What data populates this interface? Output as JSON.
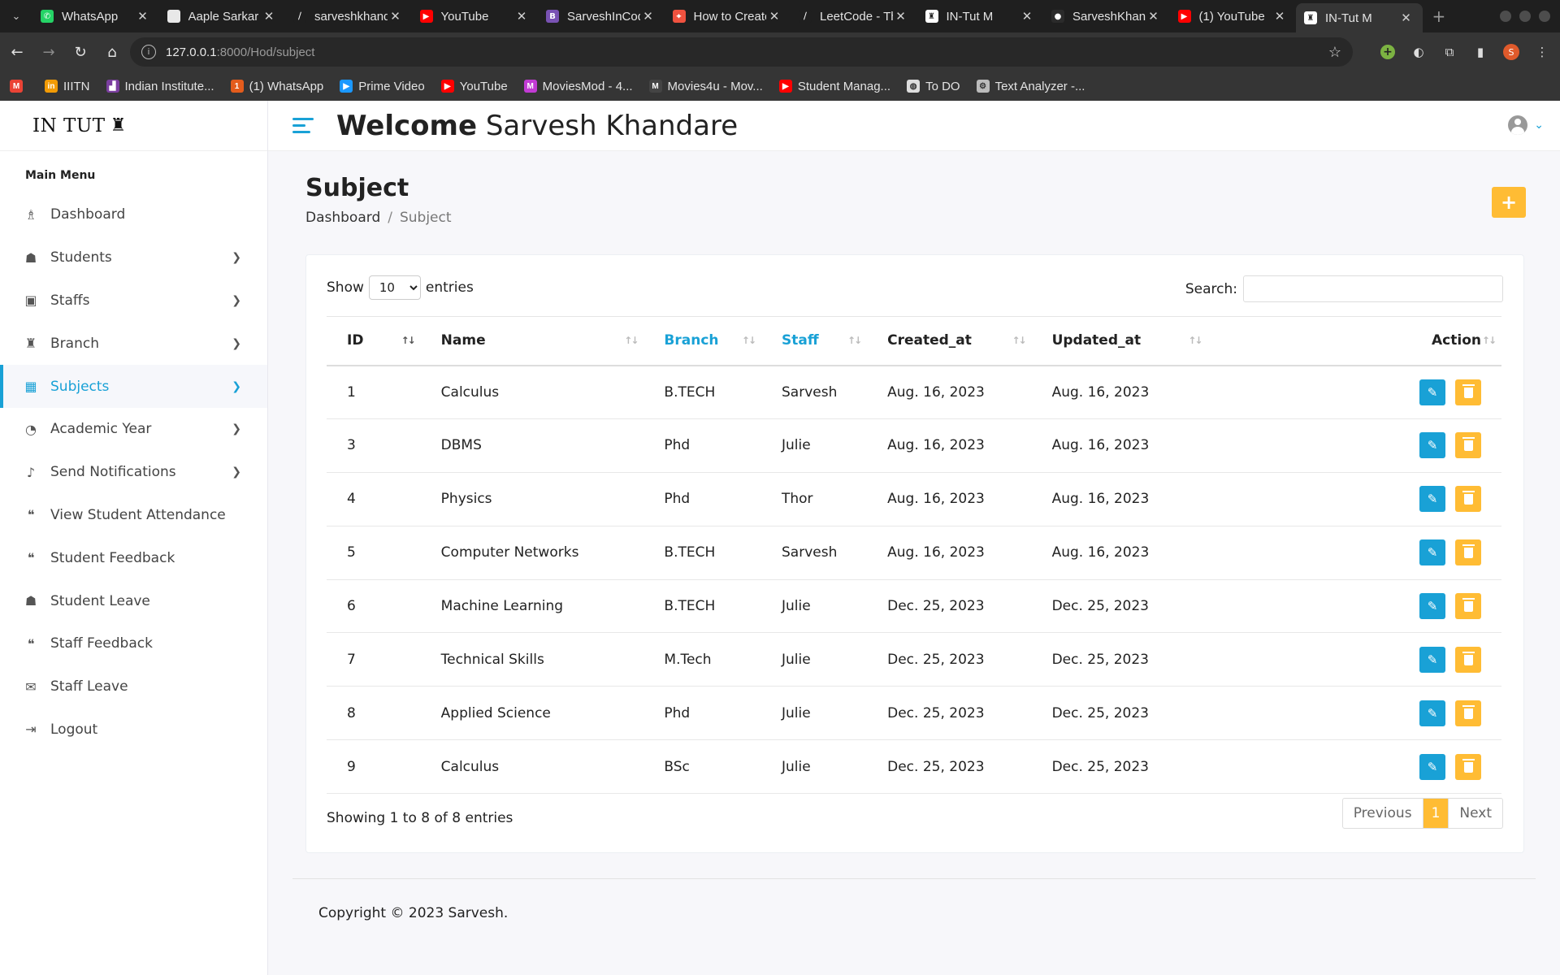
{
  "browser": {
    "tabs": [
      {
        "title": "WhatsApp",
        "icon": "whatsapp-icon",
        "color": "#25d366",
        "glyph": "✆"
      },
      {
        "title": "Aaple Sarkar",
        "icon": "document-icon",
        "color": "#e8e8e8",
        "glyph": ""
      },
      {
        "title": "sarveshkhandare",
        "icon": "hackerrank-icon",
        "color": "#1f1f1f",
        "glyph": "⧸"
      },
      {
        "title": "YouTube",
        "icon": "youtube-icon",
        "color": "#ff0000",
        "glyph": "▶"
      },
      {
        "title": "SarveshInCode",
        "icon": "bootstrap-icon",
        "color": "#7952b3",
        "glyph": "B"
      },
      {
        "title": "How to Create",
        "icon": "codingninjas-icon",
        "color": "#f0523f",
        "glyph": "⌖"
      },
      {
        "title": "LeetCode - The",
        "icon": "leetcode-icon",
        "color": "#1f1f1f",
        "glyph": "⧸"
      },
      {
        "title": "IN-Tut M",
        "icon": "intut-icon",
        "color": "#ffffff",
        "glyph": "♜"
      },
      {
        "title": "SarveshKhandare",
        "icon": "github-icon",
        "color": "#2b2b2b",
        "glyph": "●"
      },
      {
        "title": "(1) YouTube",
        "icon": "youtube-icon",
        "color": "#ff0000",
        "glyph": "▶"
      },
      {
        "title": "IN-Tut M",
        "icon": "intut-icon",
        "color": "#ffffff",
        "glyph": "♜",
        "active": true
      }
    ],
    "url_host": "127.0.0.1",
    "url_path": ":8000/Hod/subject",
    "profile_initial": "S",
    "bookmarks": [
      {
        "label": "",
        "icon": "gmail-icon",
        "color": "#ea4335",
        "glyph": "M"
      },
      {
        "label": "IIITN",
        "icon": "iiitn-icon",
        "color": "#f29b05",
        "glyph": "in"
      },
      {
        "label": "Indian Institute...",
        "icon": "institute-icon",
        "color": "#7b3fa0",
        "glyph": "▟"
      },
      {
        "label": "(1) WhatsApp",
        "icon": "whatsapp-icon",
        "color": "#e45c1c",
        "glyph": "1"
      },
      {
        "label": "Prime Video",
        "icon": "primevideo-icon",
        "color": "#1a98ff",
        "glyph": "▶"
      },
      {
        "label": "YouTube",
        "icon": "youtube-icon",
        "color": "#ff0000",
        "glyph": "▶"
      },
      {
        "label": "MoviesMod - 4...",
        "icon": "moviesmod-icon",
        "color": "#c23bd4",
        "glyph": "M"
      },
      {
        "label": "Movies4u - Mov...",
        "icon": "movies4u-icon",
        "color": "#444444",
        "glyph": "M"
      },
      {
        "label": "Student Manag...",
        "icon": "youtube-icon",
        "color": "#ff0000",
        "glyph": "▶"
      },
      {
        "label": "To DO",
        "icon": "globe-icon",
        "color": "#dddddd",
        "glyph": "◍"
      },
      {
        "label": "Text Analyzer -...",
        "icon": "gear-icon",
        "color": "#bbbbbb",
        "glyph": "⚙"
      }
    ]
  },
  "app": {
    "logo_text": "IN TUT",
    "welcome_bold": "Welcome",
    "welcome_name": "Sarvesh Khandare",
    "accent_color": "#19a1d6",
    "warning_color": "#ffbc34"
  },
  "sidebar": {
    "title": "Main Menu",
    "items": [
      {
        "label": "Dashboard",
        "icon": "dashboard-icon",
        "glyph": "♗",
        "chevron": false
      },
      {
        "label": "Students",
        "icon": "student-icon",
        "glyph": "☗",
        "chevron": true
      },
      {
        "label": "Staffs",
        "icon": "staff-icon",
        "glyph": "▣",
        "chevron": true
      },
      {
        "label": "Branch",
        "icon": "graduation-cap-icon",
        "glyph": "♜",
        "chevron": true
      },
      {
        "label": "Subjects",
        "icon": "subjects-icon",
        "glyph": "▦",
        "chevron": true,
        "active": true
      },
      {
        "label": "Academic Year",
        "icon": "clock-icon",
        "glyph": "◔",
        "chevron": true
      },
      {
        "label": "Send Notifications",
        "icon": "bell-icon",
        "glyph": "♪",
        "chevron": true
      },
      {
        "label": "View Student Attendance",
        "icon": "comments-icon",
        "glyph": "❝",
        "chevron": false
      },
      {
        "label": "Student Feedback",
        "icon": "comments-icon",
        "glyph": "❝",
        "chevron": false
      },
      {
        "label": "Student Leave",
        "icon": "student-leave-icon",
        "glyph": "☗",
        "chevron": false
      },
      {
        "label": "Staff Feedback",
        "icon": "comments-icon",
        "glyph": "❝",
        "chevron": false
      },
      {
        "label": "Staff Leave",
        "icon": "envelope-icon",
        "glyph": "✉",
        "chevron": false
      },
      {
        "label": "Logout",
        "icon": "logout-icon",
        "glyph": "⇥",
        "chevron": false
      }
    ]
  },
  "main": {
    "page_title": "Subject",
    "breadcrumb": [
      "Dashboard",
      "Subject"
    ],
    "add_button": "+",
    "show_label": "Show",
    "entries_label": "entries",
    "page_size": "10",
    "search_label": "Search:",
    "search_value": "",
    "columns": [
      "ID",
      "Name",
      "Branch",
      "Staff",
      "Created_at",
      "Updated_at",
      "Action"
    ],
    "rows": [
      [
        "1",
        "Calculus",
        "B.TECH",
        "Sarvesh",
        "Aug. 16, 2023",
        "Aug. 16, 2023"
      ],
      [
        "3",
        "DBMS",
        "Phd",
        "Julie",
        "Aug. 16, 2023",
        "Aug. 16, 2023"
      ],
      [
        "4",
        "Physics",
        "Phd",
        "Thor",
        "Aug. 16, 2023",
        "Aug. 16, 2023"
      ],
      [
        "5",
        "Computer Networks",
        "B.TECH",
        "Sarvesh",
        "Aug. 16, 2023",
        "Aug. 16, 2023"
      ],
      [
        "6",
        "Machine Learning",
        "B.TECH",
        "Julie",
        "Dec. 25, 2023",
        "Dec. 25, 2023"
      ],
      [
        "7",
        "Technical Skills",
        "M.Tech",
        "Julie",
        "Dec. 25, 2023",
        "Dec. 25, 2023"
      ],
      [
        "8",
        "Applied Science",
        "Phd",
        "Julie",
        "Dec. 25, 2023",
        "Dec. 25, 2023"
      ],
      [
        "9",
        "Calculus",
        "BSc",
        "Julie",
        "Dec. 25, 2023",
        "Dec. 25, 2023"
      ]
    ],
    "showing_text": "Showing 1 to 8 of 8 entries",
    "pagination": {
      "previous": "Previous",
      "current": "1",
      "next": "Next"
    }
  },
  "footer": {
    "copyright": "Copyright © 2023 Sarvesh."
  }
}
